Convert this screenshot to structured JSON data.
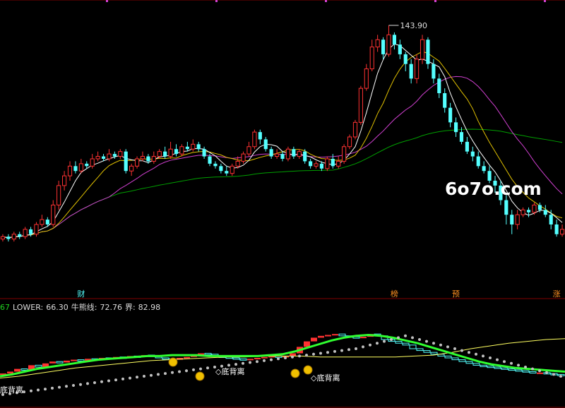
{
  "watermark": "6o7o.com",
  "indicator_row": {
    "prefix": "67",
    "lower_label": "LOWER:",
    "lower_value": "66.30",
    "bull_label": "牛熊线:",
    "bull_value": "72.76",
    "bound_label": "界:",
    "bound_value": "82.98"
  },
  "colors": {
    "up": "#ff3232",
    "down": "#54ffff",
    "ma5": "#ffffff",
    "ma10": "#e0c000",
    "ma20": "#d040d0",
    "ma60": "#00a000",
    "bull_line": "#30ff30",
    "lower_line": "#ffff60",
    "dots": "#c0c0c0",
    "prefix": "#20d020",
    "lower": "#e0e0e0",
    "bull": "#e0e0e0",
    "bound": "#e0e0e0"
  },
  "chart_data": [
    {
      "type": "candlestick",
      "title": "",
      "max_price_label": "143.90",
      "ylim": [
        44,
        152
      ],
      "markers": [
        "财",
        "榜",
        "预",
        "涨"
      ],
      "candles": [
        [
          56,
          57,
          55,
          58
        ],
        [
          57,
          56,
          55,
          58
        ],
        [
          56,
          58,
          55,
          59
        ],
        [
          58,
          57,
          56,
          59
        ],
        [
          57,
          60,
          56,
          61
        ],
        [
          60,
          58,
          57,
          61
        ],
        [
          58,
          62,
          57,
          63
        ],
        [
          62,
          64,
          61,
          66
        ],
        [
          64,
          62,
          61,
          65
        ],
        [
          62,
          70,
          61,
          72
        ],
        [
          70,
          78,
          68,
          80
        ],
        [
          78,
          82,
          76,
          84
        ],
        [
          82,
          86,
          80,
          88
        ],
        [
          86,
          84,
          83,
          88
        ],
        [
          84,
          87,
          83,
          89
        ],
        [
          87,
          86,
          85,
          88
        ],
        [
          86,
          89,
          85,
          91
        ],
        [
          89,
          90,
          88,
          92
        ],
        [
          90,
          89,
          88,
          91
        ],
        [
          89,
          91,
          88,
          93
        ],
        [
          91,
          90,
          89,
          92
        ],
        [
          90,
          92,
          89,
          93
        ],
        [
          92,
          84,
          83,
          93
        ],
        [
          84,
          86,
          82,
          87
        ],
        [
          86,
          89,
          85,
          90
        ],
        [
          89,
          90,
          88,
          92
        ],
        [
          90,
          88,
          87,
          91
        ],
        [
          88,
          90,
          87,
          92
        ],
        [
          90,
          92,
          89,
          93
        ],
        [
          92,
          90,
          89,
          94
        ],
        [
          90,
          93,
          89,
          96
        ],
        [
          93,
          91,
          90,
          95
        ],
        [
          91,
          94,
          90,
          95
        ],
        [
          94,
          93,
          92,
          96
        ],
        [
          93,
          95,
          92,
          97
        ],
        [
          95,
          93,
          92,
          96
        ],
        [
          93,
          90,
          89,
          94
        ],
        [
          90,
          87,
          86,
          91
        ],
        [
          87,
          86,
          85,
          88
        ],
        [
          86,
          84,
          83,
          87
        ],
        [
          84,
          83,
          82,
          86
        ],
        [
          83,
          86,
          82,
          87
        ],
        [
          86,
          88,
          85,
          90
        ],
        [
          88,
          91,
          87,
          92
        ],
        [
          91,
          94,
          90,
          96
        ],
        [
          94,
          100,
          93,
          101
        ],
        [
          100,
          97,
          95,
          101
        ],
        [
          97,
          93,
          92,
          98
        ],
        [
          93,
          90,
          89,
          94
        ],
        [
          90,
          91,
          89,
          93
        ],
        [
          91,
          89,
          88,
          92
        ],
        [
          89,
          93,
          88,
          94
        ],
        [
          93,
          90,
          89,
          94
        ],
        [
          90,
          92,
          89,
          93
        ],
        [
          92,
          88,
          87,
          93
        ],
        [
          88,
          86,
          85,
          89
        ],
        [
          86,
          87,
          85,
          88
        ],
        [
          87,
          85,
          84,
          88
        ],
        [
          85,
          89,
          84,
          90
        ],
        [
          89,
          86,
          85,
          91
        ],
        [
          86,
          88,
          85,
          90
        ],
        [
          88,
          94,
          87,
          95
        ],
        [
          94,
          98,
          93,
          99
        ],
        [
          98,
          104,
          97,
          105
        ],
        [
          104,
          118,
          103,
          119
        ],
        [
          118,
          126,
          117,
          128
        ],
        [
          126,
          135,
          125,
          138
        ],
        [
          135,
          138,
          133,
          140
        ],
        [
          138,
          132,
          130,
          139
        ],
        [
          132,
          140,
          131,
          143.9
        ],
        [
          140,
          136,
          134,
          141
        ],
        [
          136,
          132,
          130,
          138
        ],
        [
          132,
          128,
          125,
          133
        ],
        [
          128,
          122,
          120,
          130
        ],
        [
          122,
          130,
          120,
          132
        ],
        [
          130,
          138,
          128,
          140
        ],
        [
          138,
          128,
          126,
          139
        ],
        [
          128,
          122,
          120,
          130
        ],
        [
          122,
          116,
          114,
          124
        ],
        [
          116,
          110,
          108,
          118
        ],
        [
          110,
          104,
          102,
          112
        ],
        [
          104,
          100,
          98,
          106
        ],
        [
          100,
          96,
          95,
          102
        ],
        [
          96,
          92,
          91,
          98
        ],
        [
          92,
          90,
          88,
          94
        ],
        [
          90,
          86,
          85,
          92
        ],
        [
          86,
          84,
          83,
          88
        ],
        [
          84,
          80,
          79,
          86
        ],
        [
          80,
          78,
          75,
          82
        ],
        [
          78,
          72,
          70,
          80
        ],
        [
          72,
          66,
          62,
          74
        ],
        [
          66,
          62,
          58,
          68
        ],
        [
          62,
          66,
          60,
          68
        ],
        [
          66,
          68,
          65,
          69
        ],
        [
          68,
          67,
          65,
          69
        ],
        [
          67,
          70,
          66,
          71
        ],
        [
          70,
          68,
          67,
          71
        ],
        [
          68,
          66,
          65,
          70
        ],
        [
          66,
          62,
          60,
          68
        ],
        [
          62,
          58,
          57,
          64
        ],
        [
          58,
          60,
          57,
          62
        ]
      ]
    },
    {
      "type": "indicator",
      "ylim": [
        0,
        100
      ],
      "bars": [
        [
          32,
          33
        ],
        [
          33,
          35
        ],
        [
          35,
          38
        ],
        [
          38,
          37
        ],
        [
          37,
          42
        ],
        [
          42,
          40
        ],
        [
          40,
          44
        ],
        [
          44,
          46
        ],
        [
          46,
          45
        ],
        [
          45,
          47
        ],
        [
          47,
          48
        ],
        [
          48,
          47
        ],
        [
          47,
          49
        ],
        [
          49,
          48
        ],
        [
          48,
          50
        ],
        [
          50,
          49
        ],
        [
          49,
          51
        ],
        [
          51,
          50
        ],
        [
          50,
          52
        ],
        [
          52,
          51
        ],
        [
          51,
          53
        ],
        [
          53,
          52
        ],
        [
          52,
          50
        ],
        [
          50,
          49
        ],
        [
          49,
          48
        ],
        [
          48,
          50
        ],
        [
          50,
          51
        ],
        [
          51,
          53
        ],
        [
          53,
          55
        ],
        [
          55,
          54
        ],
        [
          54,
          52
        ],
        [
          52,
          51
        ],
        [
          51,
          50
        ],
        [
          50,
          49
        ],
        [
          49,
          48
        ],
        [
          48,
          49
        ],
        [
          49,
          50
        ],
        [
          50,
          51
        ],
        [
          51,
          52
        ],
        [
          52,
          51
        ],
        [
          51,
          52
        ],
        [
          52,
          55
        ],
        [
          55,
          62
        ],
        [
          62,
          68
        ],
        [
          68,
          72
        ],
        [
          72,
          74
        ],
        [
          74,
          75
        ],
        [
          75,
          76
        ],
        [
          76,
          74
        ],
        [
          74,
          73
        ],
        [
          73,
          72
        ],
        [
          72,
          73
        ],
        [
          73,
          76
        ],
        [
          76,
          74
        ],
        [
          74,
          70
        ],
        [
          70,
          68
        ],
        [
          68,
          66
        ],
        [
          66,
          64
        ],
        [
          64,
          60
        ],
        [
          60,
          58
        ],
        [
          58,
          56
        ],
        [
          56,
          54
        ],
        [
          54,
          52
        ],
        [
          52,
          50
        ],
        [
          50,
          48
        ],
        [
          48,
          46
        ],
        [
          46,
          44
        ],
        [
          44,
          42
        ],
        [
          42,
          41
        ],
        [
          41,
          40
        ],
        [
          40,
          39
        ],
        [
          39,
          38
        ],
        [
          38,
          37
        ],
        [
          37,
          36
        ],
        [
          36,
          35
        ],
        [
          35,
          34
        ],
        [
          34,
          34
        ],
        [
          34,
          33
        ],
        [
          33,
          32
        ],
        [
          32,
          31
        ]
      ],
      "bull_line": [
        30,
        32,
        35,
        38,
        40,
        42,
        44,
        46,
        48,
        49,
        50,
        51,
        52,
        52,
        53,
        53,
        53,
        52,
        52,
        52,
        52,
        52,
        53,
        54,
        57,
        61,
        65,
        69,
        72,
        74,
        75,
        74,
        72,
        69,
        66,
        62,
        58,
        54,
        50,
        46,
        43,
        41,
        39,
        38,
        37,
        36,
        35
      ],
      "lower_line": [
        28,
        30,
        33,
        36,
        39,
        41,
        43,
        45,
        47,
        48,
        49,
        50,
        51,
        51,
        52,
        52,
        52,
        51,
        51,
        51,
        51,
        51,
        52,
        53,
        56,
        60,
        63,
        66,
        68,
        70,
        71
      ],
      "dots": [
        10,
        11,
        12,
        13,
        14,
        15,
        16,
        17,
        18,
        19,
        20,
        21,
        22,
        23,
        24,
        25,
        26,
        27,
        28,
        29,
        30,
        31,
        32,
        33,
        34,
        35,
        36,
        37,
        38,
        39,
        40,
        41,
        42,
        43,
        44,
        45,
        46,
        47,
        48,
        49,
        50,
        51,
        52,
        53,
        54,
        55,
        56,
        57,
        58,
        59,
        60,
        62,
        64,
        66,
        68,
        70,
        72,
        74,
        72,
        70,
        68,
        66,
        64,
        62,
        60,
        58,
        56,
        54,
        52,
        50,
        48,
        46,
        44,
        42,
        40,
        38,
        36,
        34,
        32,
        30
      ],
      "annotations": [
        "底背离",
        "底背离",
        "底背离"
      ]
    }
  ]
}
